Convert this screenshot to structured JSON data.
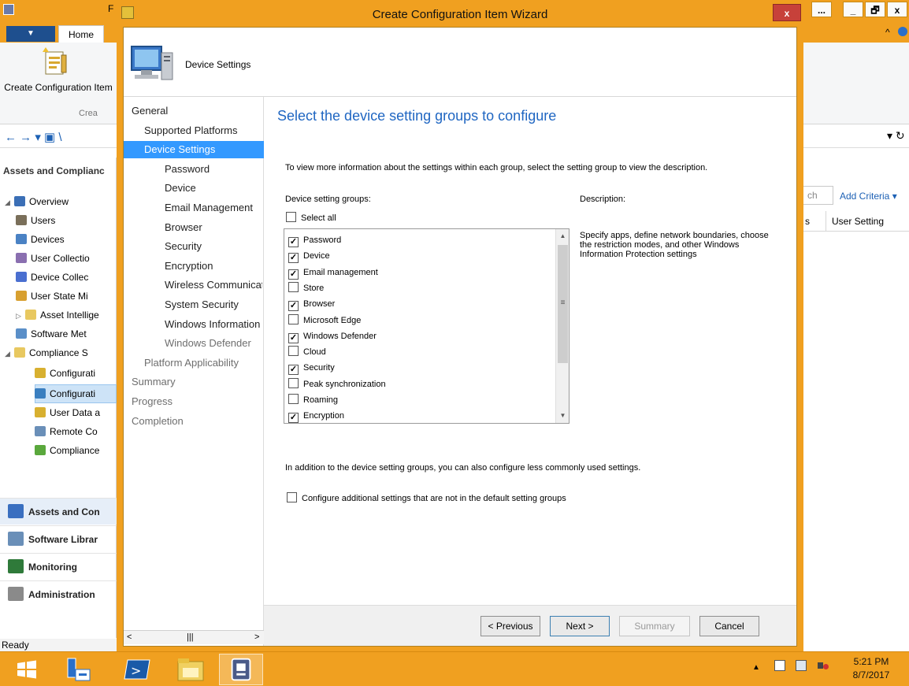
{
  "console": {
    "title_fragment": "F",
    "home_tab": "Home",
    "create_item_label": "Create Configuration Item",
    "create_group_label": "Crea",
    "left_pane_title": "Assets and Complianc",
    "tree": [
      {
        "label": "Overview",
        "icon_color": "#3b6fb6",
        "expanded": true
      },
      {
        "label": "Users",
        "icon_color": "#7a6f5a"
      },
      {
        "label": "Devices",
        "icon_color": "#4a82c4"
      },
      {
        "label": "User Collectio",
        "icon_color": "#8a6fb0"
      },
      {
        "label": "Device Collec",
        "icon_color": "#4a6fd0"
      },
      {
        "label": "User State Mi",
        "icon_color": "#d8a030"
      },
      {
        "label": "Asset Intellige",
        "icon_color": "#e8c860",
        "collapsed": true
      },
      {
        "label": "Software Met",
        "icon_color": "#5a8fc8"
      },
      {
        "label": "Compliance S",
        "icon_color": "#e8c860",
        "expanded": true
      },
      {
        "label": "Configurati",
        "icon_color": "#d8b030"
      },
      {
        "label": "Configurati",
        "icon_color": "#3a7fc0"
      },
      {
        "label": "User Data a",
        "icon_color": "#d8b030"
      },
      {
        "label": "Remote Co",
        "icon_color": "#6a8fb8"
      },
      {
        "label": "Compliance",
        "icon_color": "#5aa83c"
      }
    ],
    "workspaces": [
      {
        "label": "Assets and Con",
        "icon_color": "#3a6fc0",
        "selected": true
      },
      {
        "label": "Software Librar",
        "icon_color": "#6a8fb8"
      },
      {
        "label": "Monitoring",
        "icon_color": "#2f7a3a"
      },
      {
        "label": "Administration",
        "icon_color": "#8a8a8a"
      }
    ],
    "status": "Ready",
    "search_placeholder": "ch",
    "add_criteria": "Add Criteria ▾",
    "columns": [
      "s",
      "User Setting"
    ],
    "window_buttons": [
      "...",
      "_",
      "🗗",
      "x"
    ],
    "ribbon_help": "^"
  },
  "wizard": {
    "title": "Create Configuration Item Wizard",
    "close": "x",
    "header_label": "Device Settings",
    "nav": [
      {
        "label": "General",
        "level": 0
      },
      {
        "label": "Supported Platforms",
        "level": 1
      },
      {
        "label": "Device Settings",
        "level": 1,
        "selected": true
      },
      {
        "label": "Password",
        "level": 2
      },
      {
        "label": "Device",
        "level": 2
      },
      {
        "label": "Email Management",
        "level": 2
      },
      {
        "label": "Browser",
        "level": 2
      },
      {
        "label": "Security",
        "level": 2
      },
      {
        "label": "Encryption",
        "level": 2
      },
      {
        "label": "Wireless Communicat",
        "level": 2
      },
      {
        "label": "System Security",
        "level": 2
      },
      {
        "label": "Windows Information",
        "level": 2
      },
      {
        "label": "Windows Defender",
        "level": 2,
        "dim": true
      },
      {
        "label": "Platform Applicability",
        "level": 1,
        "dim": true
      },
      {
        "label": "Summary",
        "level": 0,
        "dim": true
      },
      {
        "label": "Progress",
        "level": 0,
        "dim": true
      },
      {
        "label": "Completion",
        "level": 0,
        "dim": true
      }
    ],
    "heading": "Select the device setting groups to configure",
    "info": "To view more information about the settings within each group, select the setting group to view the description.",
    "groups_label": "Device setting groups:",
    "description_label": "Description:",
    "select_all": "Select all",
    "groups": [
      {
        "label": "Password",
        "checked": true
      },
      {
        "label": "Device",
        "checked": true
      },
      {
        "label": "Email management",
        "checked": true
      },
      {
        "label": "Store",
        "checked": false
      },
      {
        "label": "Browser",
        "checked": true
      },
      {
        "label": "Microsoft Edge",
        "checked": false
      },
      {
        "label": "Windows Defender",
        "checked": true
      },
      {
        "label": "Cloud",
        "checked": false
      },
      {
        "label": "Security",
        "checked": true
      },
      {
        "label": "Peak synchronization",
        "checked": false
      },
      {
        "label": "Roaming",
        "checked": false
      },
      {
        "label": "Encryption",
        "checked": true
      }
    ],
    "description": "Specify apps, define network boundaries, choose the restriction modes, and other Windows Information Protection settings",
    "additional_info": "In addition to the device setting groups, you can also configure less commonly used settings.",
    "additional_checkbox": "Configure additional settings that are not in the default setting groups",
    "buttons": {
      "previous": "< Previous",
      "next": "Next >",
      "summary": "Summary",
      "cancel": "Cancel"
    }
  },
  "taskbar": {
    "time": "5:21 PM",
    "date": "8/7/2017",
    "tray_arrow": "▲"
  }
}
